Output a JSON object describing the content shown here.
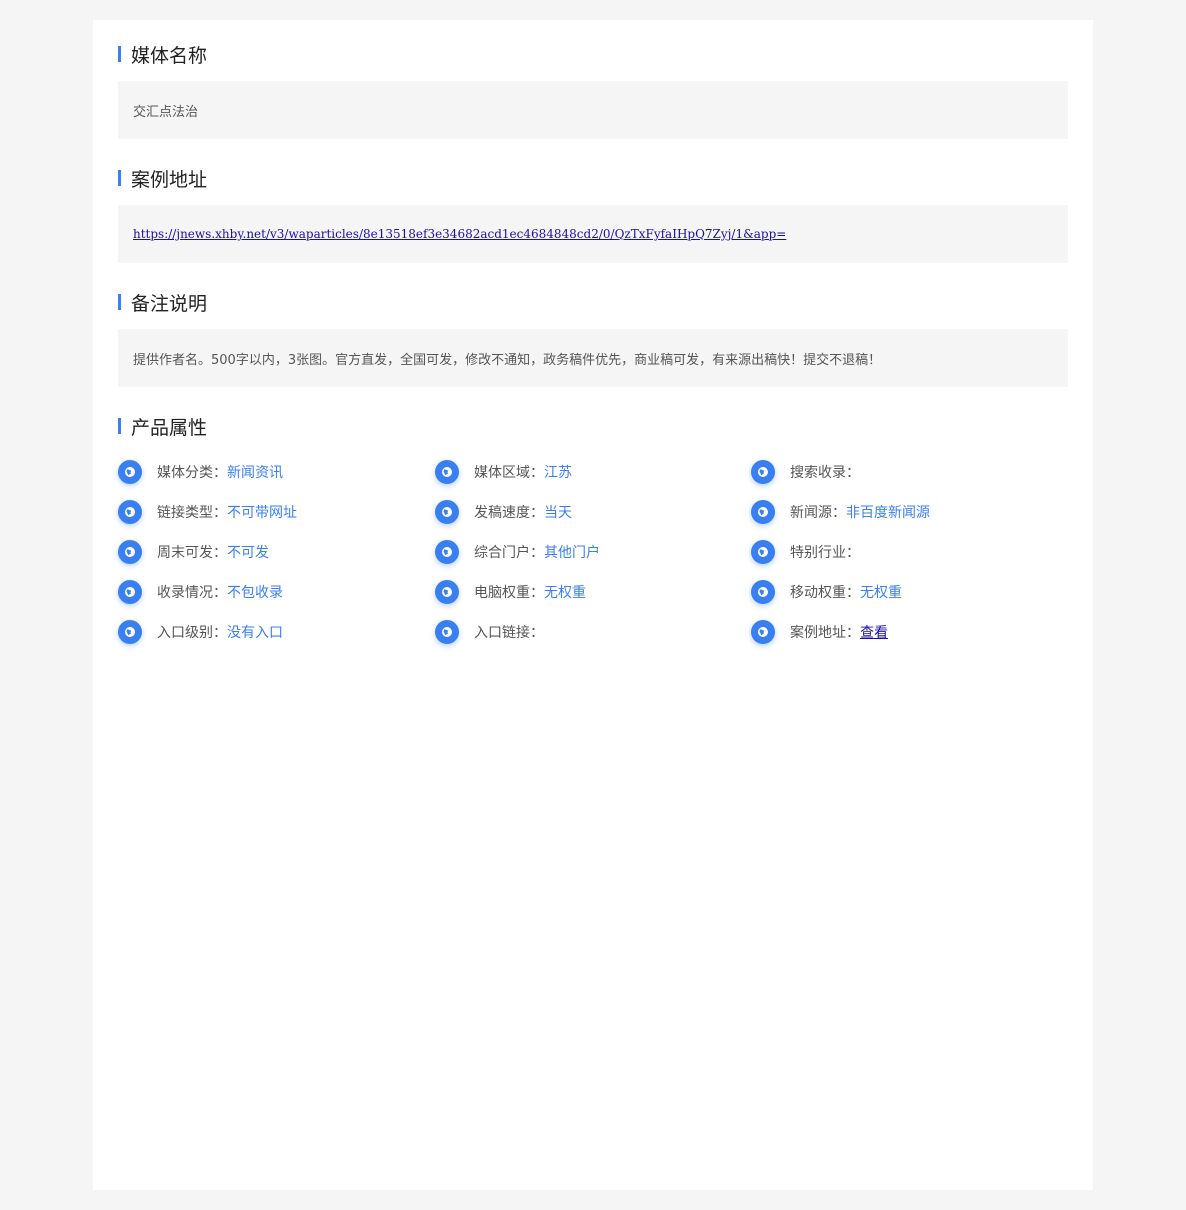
{
  "sections": {
    "media_name": {
      "title": "媒体名称",
      "value": "交汇点法治"
    },
    "case_url": {
      "title": "案例地址",
      "value": "https://jnews.xhby.net/v3/waparticles/8e13518ef3e34682acd1ec4684848cd2/0/QzTxFyfaIHpQ7Zyj/1&app="
    },
    "remarks": {
      "title": "备注说明",
      "value": "提供作者名。500字以内，3张图。官方直发，全国可发，修改不通知，政务稿件优先，商业稿可发，有来源出稿快！提交不退稿！"
    },
    "attributes": {
      "title": "产品属性"
    }
  },
  "attributes": [
    {
      "label": "媒体分类：",
      "value": "新闻资讯",
      "icon": "globe-icon"
    },
    {
      "label": "媒体区域：",
      "value": "江苏",
      "icon": "globe-icon"
    },
    {
      "label": "搜索收录：",
      "value": "",
      "icon": "globe-icon"
    },
    {
      "label": "链接类型：",
      "value": "不可带网址",
      "icon": "globe-icon"
    },
    {
      "label": "发稿速度：",
      "value": "当天",
      "icon": "globe-icon"
    },
    {
      "label": "新闻源：",
      "value": "非百度新闻源",
      "icon": "globe-icon"
    },
    {
      "label": "周末可发：",
      "value": "不可发",
      "icon": "globe-icon"
    },
    {
      "label": "综合门户：",
      "value": "其他门户",
      "icon": "globe-icon"
    },
    {
      "label": "特别行业：",
      "value": "",
      "icon": "globe-icon"
    },
    {
      "label": "收录情况：",
      "value": "不包收录",
      "icon": "globe-icon"
    },
    {
      "label": "电脑权重：",
      "value": "无权重",
      "icon": "globe-icon"
    },
    {
      "label": "移动权重：",
      "value": "无权重",
      "icon": "globe-icon"
    },
    {
      "label": "入口级别：",
      "value": "没有入口",
      "icon": "globe-icon"
    },
    {
      "label": "入口链接：",
      "value": "",
      "icon": "globe-icon"
    },
    {
      "label": "案例地址：",
      "value": "查看",
      "icon": "globe-icon"
    }
  ],
  "colors": {
    "accent": "#3a7ff0",
    "link": "#1a0dab",
    "page_background": "#f5f5f5",
    "card_background": "#ffffff",
    "box_background": "#f5f5f5"
  }
}
